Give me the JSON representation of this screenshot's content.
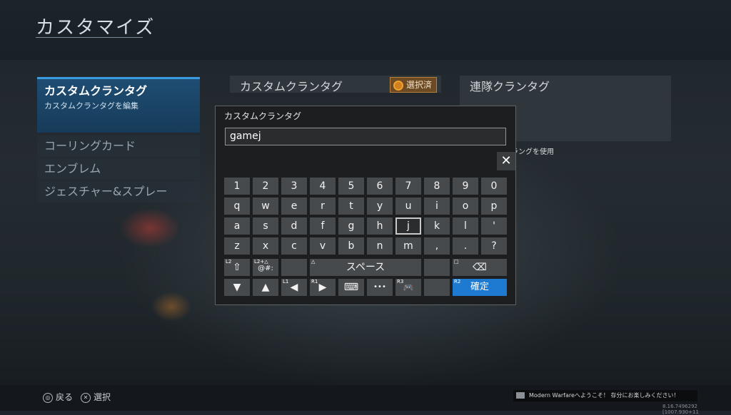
{
  "header": {
    "title": "カスタマイズ"
  },
  "sidebar": {
    "active": {
      "label": "カスタムクランタグ",
      "sublabel": "カスタムクランタグを編集"
    },
    "items": [
      {
        "label": "コーリングカード"
      },
      {
        "label": "エンブレム"
      },
      {
        "label": "ジェスチャー&スプレー"
      }
    ]
  },
  "panels": {
    "custom_tag": {
      "title": "カスタムクランタグ",
      "badge": "選択済"
    },
    "regiment_tag": {
      "title": "連隊クランタグ",
      "hint": "ラングを使用"
    }
  },
  "keyboard": {
    "title": "カスタムクランタグ",
    "input_value": "gamej",
    "close_symbol": "✕",
    "rows": [
      [
        "1",
        "2",
        "3",
        "4",
        "5",
        "6",
        "7",
        "8",
        "9",
        "0"
      ],
      [
        "q",
        "w",
        "e",
        "r",
        "t",
        "y",
        "u",
        "i",
        "o",
        "p"
      ],
      [
        "a",
        "s",
        "d",
        "f",
        "g",
        "h",
        "j",
        "k",
        "l",
        "'"
      ],
      [
        "z",
        "x",
        "c",
        "v",
        "b",
        "n",
        "m",
        ",",
        ".",
        "?"
      ]
    ],
    "focused_key": "j",
    "special": {
      "shift_hint": "L2",
      "shift_symbol": "⇧",
      "symbols_hint": "L2+△",
      "symbols_label": "@#:",
      "space_hint": "△",
      "space_label": "スペース",
      "backspace_hint": "□",
      "backspace_symbol": "⌫",
      "down_symbol": "▼",
      "up_symbol": "▲",
      "left_hint": "L1",
      "left_symbol": "◀",
      "right_hint": "R1",
      "right_symbol": "▶",
      "keyboard_symbol": "⌨",
      "more_label": "•••",
      "gamepad_hint": "R3",
      "gamepad_symbol": "🎮",
      "confirm_hint": "R2",
      "confirm_label": "確定"
    }
  },
  "footer": {
    "back_icon": "◎",
    "back_label": "戻る",
    "select_icon": "✕",
    "select_label": "選択",
    "notification": "Modern Warfareへようこそ！ 存分にお楽しみください！",
    "version": "8.16.7496292 [1007.930+11"
  },
  "colors": {
    "accent": "#3b9be0",
    "confirm": "#1e7ad0",
    "badge": "#b9803a"
  }
}
